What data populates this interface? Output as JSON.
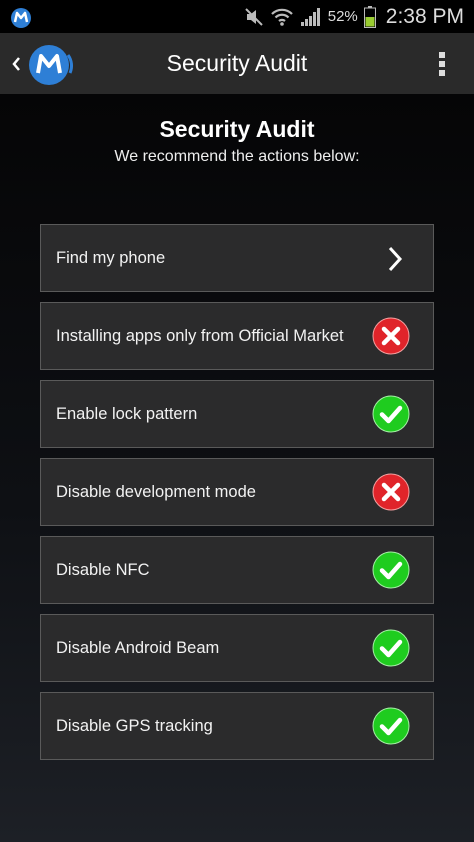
{
  "status_bar": {
    "battery_percent": "52%",
    "time": "2:38 PM"
  },
  "action_bar": {
    "title": "Security Audit"
  },
  "audit": {
    "heading": "Security Audit",
    "subheading": "We recommend the actions below:",
    "items": [
      {
        "label": "Find my phone",
        "state": "navigate",
        "icon": "chevron-right-icon"
      },
      {
        "label": "Installing apps only from Official Market",
        "state": "fail",
        "icon": "red-x-icon"
      },
      {
        "label": "Enable lock pattern",
        "state": "pass",
        "icon": "green-check-icon"
      },
      {
        "label": "Disable development mode",
        "state": "fail",
        "icon": "red-x-icon"
      },
      {
        "label": "Disable NFC",
        "state": "pass",
        "icon": "green-check-icon"
      },
      {
        "label": "Disable Android Beam",
        "state": "pass",
        "icon": "green-check-icon"
      },
      {
        "label": "Disable GPS tracking",
        "state": "pass",
        "icon": "green-check-icon"
      }
    ]
  },
  "colors": {
    "pass": "#1fcc1f",
    "fail": "#e0242a",
    "action_bar": "#2a2a2a",
    "row_background": "#2b2b2c",
    "brand_blue": "#2e7fd6"
  }
}
